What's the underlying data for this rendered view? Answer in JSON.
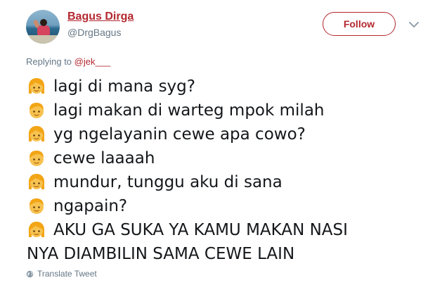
{
  "user": {
    "display_name": "Bagus Dirga",
    "username": "@DrgBagus"
  },
  "actions": {
    "follow_label": "Follow"
  },
  "reply": {
    "prefix": "Replying to",
    "mention": "@jek___"
  },
  "lines": [
    {
      "emoji": "girl-emoji",
      "text": "lagi di mana syg?"
    },
    {
      "emoji": "boy-emoji",
      "text": "lagi makan di warteg mpok milah"
    },
    {
      "emoji": "girl-emoji",
      "text": "yg ngelayanin cewe apa cowo?"
    },
    {
      "emoji": "boy-emoji",
      "text": "cewe laaaah"
    },
    {
      "emoji": "girl-emoji",
      "text": "mundur, tunggu aku di sana"
    },
    {
      "emoji": "boy-emoji",
      "text": "ngapain?"
    },
    {
      "emoji": "girl-emoji",
      "text": "AKU GA SUKA YA KAMU MAKAN NASI"
    },
    {
      "emoji": "",
      "text": "NYA DIAMBILIN SAMA CEWE LAIN"
    }
  ],
  "footer": {
    "translate_label": "Translate Tweet"
  },
  "colors": {
    "accent": "#b3272f",
    "muted": "#657786",
    "text": "#14171a",
    "emoji_skin": "#f7c24f",
    "emoji_hair": "#f2a516"
  }
}
